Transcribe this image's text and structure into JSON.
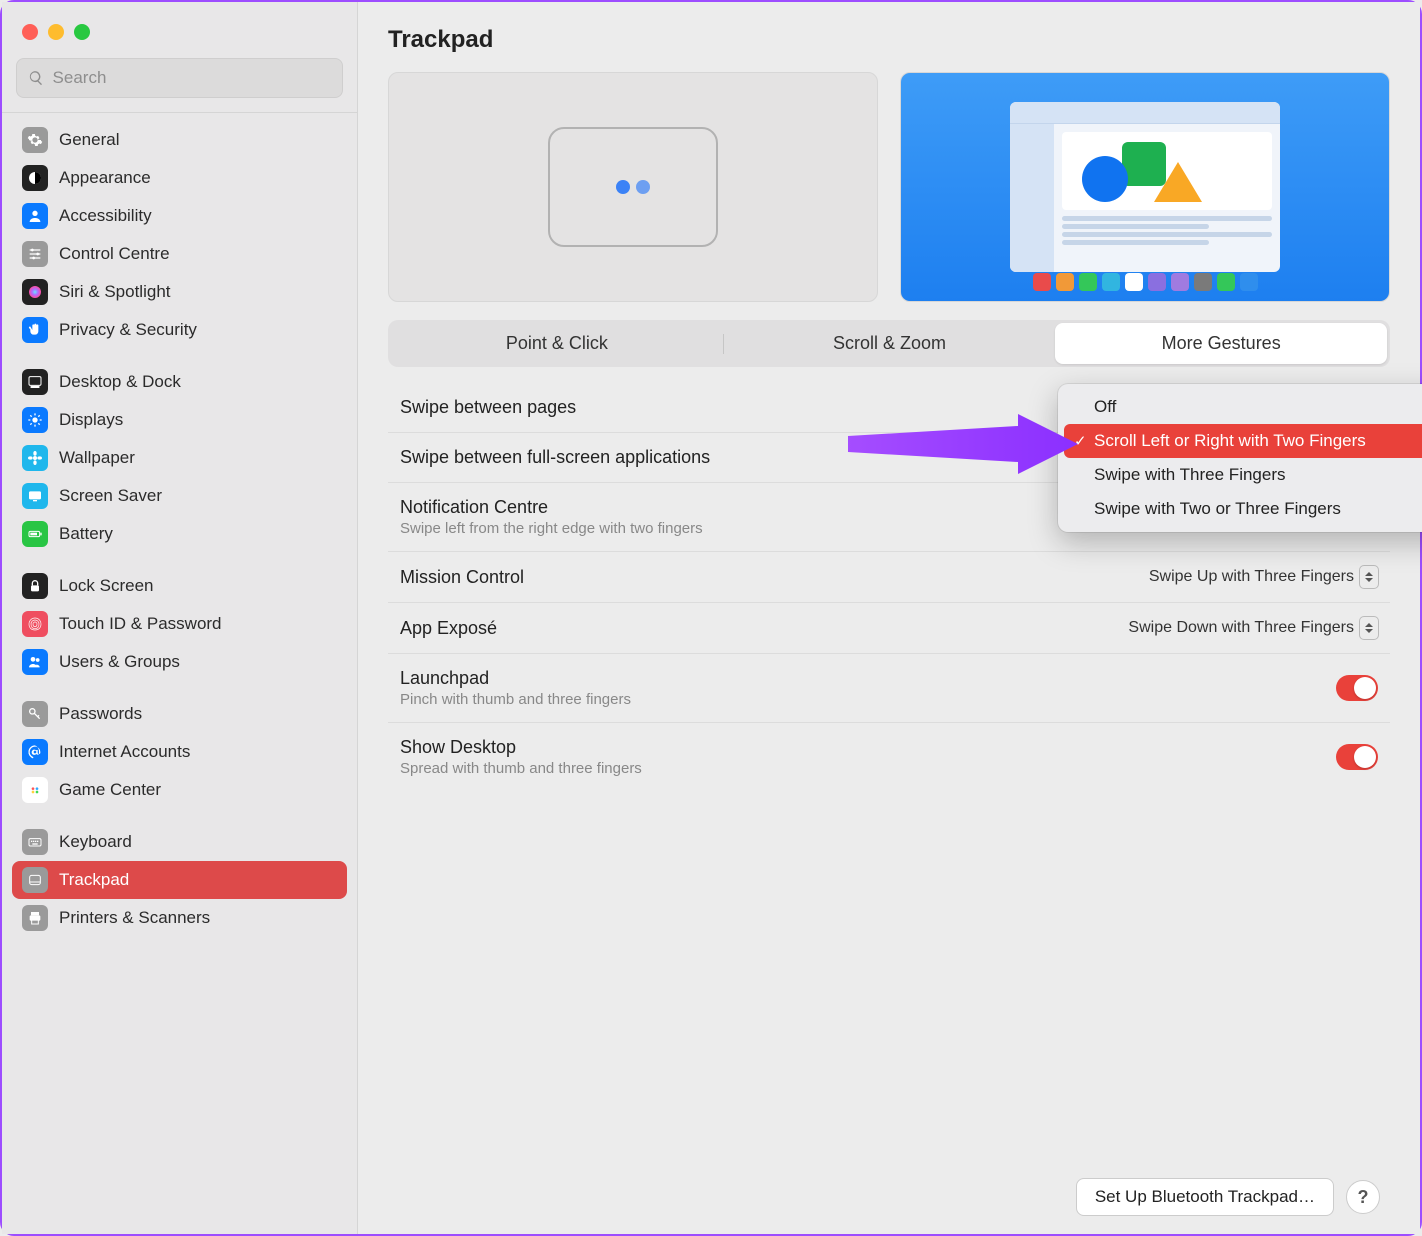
{
  "search": {
    "placeholder": "Search"
  },
  "sidebar": {
    "groups": [
      [
        {
          "label": "General",
          "bg": "#9a9a9a",
          "icon": "gear"
        },
        {
          "label": "Appearance",
          "bg": "#222",
          "icon": "appearance"
        },
        {
          "label": "Accessibility",
          "bg": "#0a7aff",
          "icon": "person"
        },
        {
          "label": "Control Centre",
          "bg": "#9a9a9a",
          "icon": "sliders"
        },
        {
          "label": "Siri & Spotlight",
          "bg": "#222",
          "icon": "siri"
        },
        {
          "label": "Privacy & Security",
          "bg": "#0a7aff",
          "icon": "hand"
        }
      ],
      [
        {
          "label": "Desktop & Dock",
          "bg": "#222",
          "icon": "dock"
        },
        {
          "label": "Displays",
          "bg": "#0a7aff",
          "icon": "sun"
        },
        {
          "label": "Wallpaper",
          "bg": "#1fb7ec",
          "icon": "flower"
        },
        {
          "label": "Screen Saver",
          "bg": "#1fb7ec",
          "icon": "screen"
        },
        {
          "label": "Battery",
          "bg": "#29c544",
          "icon": "battery"
        }
      ],
      [
        {
          "label": "Lock Screen",
          "bg": "#222",
          "icon": "lock"
        },
        {
          "label": "Touch ID & Password",
          "bg": "#ef4e60",
          "icon": "finger"
        },
        {
          "label": "Users & Groups",
          "bg": "#0a7aff",
          "icon": "users"
        }
      ],
      [
        {
          "label": "Passwords",
          "bg": "#9a9a9a",
          "icon": "key"
        },
        {
          "label": "Internet Accounts",
          "bg": "#0a7aff",
          "icon": "at"
        },
        {
          "label": "Game Center",
          "bg": "#fff",
          "icon": "game"
        }
      ],
      [
        {
          "label": "Keyboard",
          "bg": "#9a9a9a",
          "icon": "keyboard"
        },
        {
          "label": "Trackpad",
          "bg": "#9a9a9a",
          "icon": "trackpad",
          "selected": true
        },
        {
          "label": "Printers & Scanners",
          "bg": "#9a9a9a",
          "icon": "printer"
        }
      ]
    ]
  },
  "title": "Trackpad",
  "tabs": [
    "Point & Click",
    "Scroll & Zoom",
    "More Gestures"
  ],
  "active_tab": 2,
  "popup": {
    "options": [
      "Off",
      "Scroll Left or Right with Two Fingers",
      "Swipe with Three Fingers",
      "Swipe with Two or Three Fingers"
    ],
    "selected": 1
  },
  "settings": [
    {
      "label": "Swipe between pages",
      "ctl": "popup"
    },
    {
      "label": "Swipe between full-screen applications",
      "ctl": "none"
    },
    {
      "label": "Notification Centre",
      "sub": "Swipe left from the right edge with two fingers",
      "ctl": "toggle",
      "on": true
    },
    {
      "label": "Mission Control",
      "ctl": "select",
      "value": "Swipe Up with Three Fingers"
    },
    {
      "label": "App Exposé",
      "ctl": "select",
      "value": "Swipe Down with Three Fingers"
    },
    {
      "label": "Launchpad",
      "sub": "Pinch with thumb and three fingers",
      "ctl": "toggle",
      "on": true
    },
    {
      "label": "Show Desktop",
      "sub": "Spread with thumb and three fingers",
      "ctl": "toggle",
      "on": true
    }
  ],
  "footer": {
    "bluetooth": "Set Up Bluetooth Trackpad…",
    "help": "?"
  },
  "dock_colors": [
    "#e94b4b",
    "#f19938",
    "#34c759",
    "#31b5e0",
    "#ffffff",
    "#8a6fe0",
    "#a07be0",
    "#7a7a7a",
    "#34c759",
    "#2f8eed"
  ]
}
